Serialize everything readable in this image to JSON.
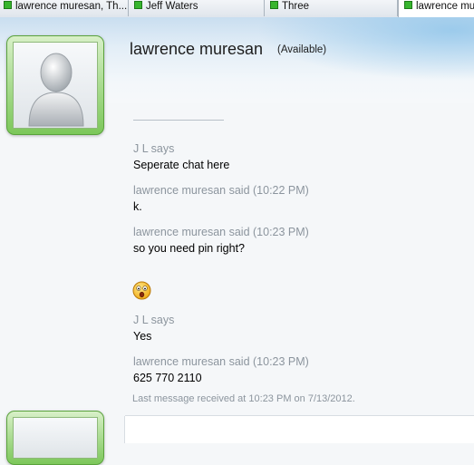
{
  "tabs": [
    {
      "label": "lawrence muresan, Th...",
      "active": false
    },
    {
      "label": "Jeff Waters",
      "active": false
    },
    {
      "label": "Three",
      "active": false
    },
    {
      "label": "lawrence mu",
      "active": true
    }
  ],
  "contact": {
    "name": "lawrence muresan",
    "status": "(Available)"
  },
  "messages": [
    {
      "sender": "J L says",
      "text": "Seperate chat here"
    },
    {
      "sender": "lawrence muresan said (10:22 PM)",
      "text": "k."
    },
    {
      "sender": "lawrence muresan said (10:23 PM)",
      "text": "so you need pin right?",
      "emoticon": "surprised-face-icon"
    },
    {
      "sender": "J L says",
      "text": "Yes"
    },
    {
      "sender": "lawrence muresan said (10:23 PM)",
      "text": "625 770 2110"
    }
  ],
  "footer": "Last message received at 10:23 PM on 7/13/2012.",
  "colors": {
    "tab_dot": "#38b52e",
    "avatar_frame": "#7cc75a",
    "sender_gray": "#8c959e"
  }
}
